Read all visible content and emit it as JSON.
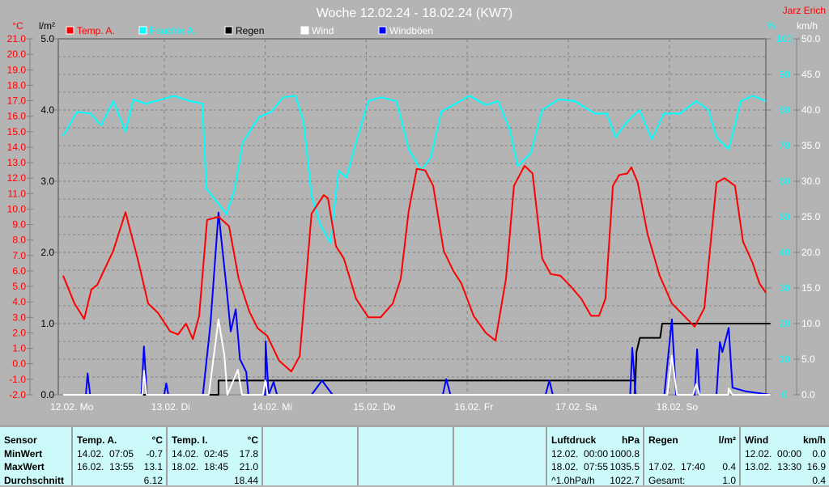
{
  "title": "Woche 12.02.24 - 18.02.24 (KW7)",
  "author": "Jarz Erich",
  "colors": {
    "temp": "#ff0000",
    "hum": "#00ffff",
    "rain": "#000000",
    "wind": "#ffffff",
    "gust": "#0000ff"
  },
  "chart_data": {
    "type": "line",
    "title": "Woche 12.02.24 - 18.02.24 (KW7)",
    "legend": [
      "Temp. A.",
      "Feuchte A.",
      "Regen",
      "Wind",
      "Windböen"
    ],
    "legend_position": "top",
    "axis_units": {
      "temp": "°C",
      "rain": "l/m²",
      "hum": "%",
      "wind": "km/h"
    },
    "xlim_hours": [
      0,
      168
    ],
    "x_tick_labels": [
      "12.02.  Mo",
      "13.02.  Di",
      "14.02.  Mi",
      "15.02.  Do",
      "16.02.  Fr",
      "17.02.  Sa",
      "18.02.  So"
    ],
    "ylim": {
      "temp": [
        -2,
        21
      ],
      "rain": [
        0,
        5
      ],
      "hum": [
        0,
        100
      ],
      "wind": [
        0,
        50
      ]
    },
    "temp_ticks": [
      "21.0",
      "20.0",
      "19.0",
      "18.0",
      "17.0",
      "16.0",
      "15.0",
      "14.0",
      "13.0",
      "12.0",
      "11.0",
      "10.0",
      "9.0",
      "8.0",
      "7.0",
      "6.0",
      "5.0",
      "4.0",
      "3.0",
      "2.0",
      "1.0",
      "0.0",
      "-1.0",
      "-2.0"
    ],
    "rain_ticks": [
      "5.0",
      "4.0",
      "3.0",
      "2.0",
      "1.0",
      "0.0"
    ],
    "hum_ticks": [
      "100",
      "90",
      "80",
      "70",
      "60",
      "50",
      "40",
      "30",
      "20",
      "10",
      "0"
    ],
    "wind_ticks": [
      "50.0",
      "45.0",
      "40.0",
      "35.0",
      "30.0",
      "25.0",
      "20.0",
      "15.0",
      "10.0",
      "5.0",
      "0.0"
    ],
    "series": [
      {
        "name": "Temp. A.",
        "axis": "temp",
        "points": [
          [
            0,
            5.7
          ],
          [
            2.7,
            3.9
          ],
          [
            5,
            2.9
          ],
          [
            6.7,
            4.8
          ],
          [
            8.1,
            5.1
          ],
          [
            11.9,
            7.3
          ],
          [
            14.8,
            9.8
          ],
          [
            17.7,
            6.8
          ],
          [
            20.2,
            3.9
          ],
          [
            22.5,
            3.3
          ],
          [
            25.4,
            2.1
          ],
          [
            27.3,
            1.9
          ],
          [
            29.2,
            2.6
          ],
          [
            30.8,
            1.6
          ],
          [
            32.3,
            3.1
          ],
          [
            34.2,
            9.3
          ],
          [
            36.9,
            9.5
          ],
          [
            39.4,
            8.9
          ],
          [
            41.7,
            5.5
          ],
          [
            44.2,
            3.4
          ],
          [
            46.2,
            2.3
          ],
          [
            48.5,
            1.8
          ],
          [
            51.3,
            0.2
          ],
          [
            54.2,
            -0.5
          ],
          [
            56.2,
            0.5
          ],
          [
            59,
            9.7
          ],
          [
            61.9,
            10.9
          ],
          [
            62.9,
            10.7
          ],
          [
            64.8,
            7.6
          ],
          [
            66.7,
            6.8
          ],
          [
            69.6,
            4.2
          ],
          [
            72.5,
            3.0
          ],
          [
            75.4,
            3.0
          ],
          [
            78.3,
            3.9
          ],
          [
            80.2,
            5.5
          ],
          [
            82.1,
            9.9
          ],
          [
            84,
            12.6
          ],
          [
            86,
            12.5
          ],
          [
            87.9,
            11.5
          ],
          [
            90.4,
            7.3
          ],
          [
            92.7,
            6.0
          ],
          [
            94.6,
            5.2
          ],
          [
            97.5,
            3.1
          ],
          [
            100.4,
            2.0
          ],
          [
            102.7,
            1.5
          ],
          [
            105.2,
            5.5
          ],
          [
            107.1,
            11.5
          ],
          [
            109.6,
            12.8
          ],
          [
            111.5,
            12.3
          ],
          [
            113.8,
            6.8
          ],
          [
            115.8,
            5.8
          ],
          [
            118.1,
            5.7
          ],
          [
            120.6,
            5.0
          ],
          [
            123.1,
            4.2
          ],
          [
            125.4,
            3.1
          ],
          [
            127.3,
            3.1
          ],
          [
            128.8,
            4.2
          ],
          [
            130.6,
            11.5
          ],
          [
            132.1,
            12.2
          ],
          [
            134,
            12.3
          ],
          [
            135,
            12.7
          ],
          [
            136.5,
            11.7
          ],
          [
            138.8,
            8.4
          ],
          [
            141.7,
            5.7
          ],
          [
            144.6,
            3.9
          ],
          [
            147.5,
            3.1
          ],
          [
            150,
            2.4
          ],
          [
            152.3,
            3.6
          ],
          [
            155.2,
            11.7
          ],
          [
            157.1,
            12.0
          ],
          [
            159.6,
            11.5
          ],
          [
            161.5,
            7.9
          ],
          [
            163.8,
            6.5
          ],
          [
            165.4,
            5.2
          ],
          [
            166.9,
            4.6
          ]
        ]
      },
      {
        "name": "Feuchte A.",
        "axis": "hum",
        "points": [
          [
            0,
            72.7
          ],
          [
            3.3,
            79.5
          ],
          [
            6.5,
            79
          ],
          [
            9,
            75.7
          ],
          [
            11.9,
            82.5
          ],
          [
            14.8,
            74
          ],
          [
            16.7,
            83
          ],
          [
            19.6,
            81.8
          ],
          [
            23.5,
            83
          ],
          [
            26.3,
            84
          ],
          [
            30.2,
            82.5
          ],
          [
            33.1,
            81.8
          ],
          [
            34,
            58
          ],
          [
            36,
            55
          ],
          [
            38.8,
            50.7
          ],
          [
            40.8,
            58
          ],
          [
            42.7,
            71
          ],
          [
            44.6,
            74.5
          ],
          [
            46.5,
            78
          ],
          [
            49.4,
            79.5
          ],
          [
            52.3,
            83.6
          ],
          [
            55.2,
            84
          ],
          [
            57.1,
            76.8
          ],
          [
            59,
            56
          ],
          [
            61,
            48
          ],
          [
            63.5,
            42.7
          ],
          [
            65.4,
            63
          ],
          [
            67.3,
            61
          ],
          [
            69.6,
            71
          ],
          [
            72.5,
            82.5
          ],
          [
            75.4,
            83.6
          ],
          [
            79.2,
            82.5
          ],
          [
            82.1,
            69
          ],
          [
            85,
            63
          ],
          [
            87.3,
            66.6
          ],
          [
            89.8,
            79.5
          ],
          [
            92.7,
            81.4
          ],
          [
            96.5,
            84
          ],
          [
            100.4,
            81.4
          ],
          [
            103.3,
            82.5
          ],
          [
            106.1,
            74.5
          ],
          [
            108,
            64.3
          ],
          [
            111,
            67.7
          ],
          [
            113.8,
            80
          ],
          [
            117.7,
            83
          ],
          [
            121.5,
            82.5
          ],
          [
            126.3,
            79
          ],
          [
            129.2,
            79
          ],
          [
            131.2,
            72.3
          ],
          [
            134,
            76.8
          ],
          [
            136.9,
            80
          ],
          [
            139.8,
            71.8
          ],
          [
            142.7,
            79
          ],
          [
            146.5,
            79
          ],
          [
            150.4,
            82.5
          ],
          [
            153.3,
            80
          ],
          [
            155.2,
            72.3
          ],
          [
            158.1,
            69
          ],
          [
            161,
            82.5
          ],
          [
            163.8,
            84
          ],
          [
            166.9,
            82.5
          ]
        ]
      },
      {
        "name": "Regen",
        "axis": "rain",
        "points": [
          [
            0,
            0
          ],
          [
            36.9,
            0
          ],
          [
            36.9,
            0.2
          ],
          [
            135.8,
            0.2
          ],
          [
            135.8,
            0
          ],
          [
            136.2,
            0.6
          ],
          [
            137,
            0.8
          ],
          [
            141.8,
            0.8
          ],
          [
            142.3,
            1.0
          ],
          [
            168,
            1.0
          ]
        ]
      },
      {
        "name": "Wind",
        "axis": "wind",
        "points": [
          [
            0,
            0
          ],
          [
            18.8,
            0
          ],
          [
            19.2,
            3.4
          ],
          [
            19.8,
            0
          ],
          [
            34.6,
            0
          ],
          [
            36.9,
            10.6
          ],
          [
            38.3,
            5.5
          ],
          [
            39,
            0
          ],
          [
            41.5,
            3.5
          ],
          [
            42.5,
            0
          ],
          [
            47.5,
            0
          ],
          [
            48,
            2
          ],
          [
            48.6,
            0
          ],
          [
            143.5,
            0
          ],
          [
            144.6,
            5.5
          ],
          [
            145.8,
            0
          ],
          [
            149.6,
            0
          ],
          [
            150.4,
            1.5
          ],
          [
            151.2,
            0
          ],
          [
            158,
            0
          ],
          [
            158.1,
            0.9
          ],
          [
            159,
            0
          ],
          [
            168,
            0
          ]
        ]
      },
      {
        "name": "Windböen",
        "axis": "gust",
        "points": [
          [
            0,
            0
          ],
          [
            5.4,
            0
          ],
          [
            5.8,
            3
          ],
          [
            6.4,
            0
          ],
          [
            18.6,
            0
          ],
          [
            19.2,
            6.8
          ],
          [
            19.9,
            0
          ],
          [
            24,
            0
          ],
          [
            24.5,
            1.6
          ],
          [
            25,
            0
          ],
          [
            33.2,
            0
          ],
          [
            35,
            10
          ],
          [
            36.9,
            25.6
          ],
          [
            38.8,
            15
          ],
          [
            39.8,
            8.9
          ],
          [
            41,
            12
          ],
          [
            42,
            5
          ],
          [
            43.5,
            3.2
          ],
          [
            44,
            0
          ],
          [
            48,
            0
          ],
          [
            48.1,
            7.5
          ],
          [
            48.8,
            0
          ],
          [
            50,
            1.8
          ],
          [
            50.8,
            0
          ],
          [
            59,
            0
          ],
          [
            61.5,
            2
          ],
          [
            64,
            0
          ],
          [
            90.2,
            0
          ],
          [
            91,
            2.2
          ],
          [
            92,
            0
          ],
          [
            114.6,
            0
          ],
          [
            115.5,
            2
          ],
          [
            116.3,
            0
          ],
          [
            134.7,
            0
          ],
          [
            135.2,
            6.6
          ],
          [
            136,
            0
          ],
          [
            142.8,
            0
          ],
          [
            144.6,
            10.6
          ],
          [
            145.6,
            0
          ],
          [
            150,
            0
          ],
          [
            150.6,
            6.4
          ],
          [
            151.2,
            0
          ],
          [
            155.2,
            0
          ],
          [
            156,
            7.4
          ],
          [
            156.6,
            6
          ],
          [
            158.1,
            9.4
          ],
          [
            159,
            1
          ],
          [
            162,
            0.5
          ],
          [
            168,
            0
          ]
        ]
      }
    ]
  },
  "table": {
    "sensor_col": [
      "Sensor",
      "MinWert",
      "MaxWert",
      "Durchschnitt"
    ],
    "temp_a": {
      "header": "Temp. A.",
      "unit": "°C",
      "min_time": "14.02.  07:05",
      "min": "-0.7",
      "max_time": "16.02.  13:55",
      "max": "13.1",
      "avg": "6.12"
    },
    "temp_i": {
      "header": "Temp. I.",
      "unit": "°C",
      "min_time": "14.02.  02:45",
      "min": "17.8",
      "max_time": "18.02.  18:45",
      "max": "21.0",
      "avg": "18.44"
    },
    "pressure": {
      "header": "Luftdruck",
      "unit": "hPa",
      "min_time": "12.02.  00:00",
      "min": "1000.8",
      "max_time": "18.02.  07:55",
      "max": "1035.5",
      "trend": "^1.0hPa/h",
      "avg": "1022.7"
    },
    "rain": {
      "header": "Regen",
      "unit": "l/m²",
      "max_time": "17.02.  17:40",
      "max": "0.4",
      "total_label": "Gesamt:",
      "total": "1.0"
    },
    "wind": {
      "header": "Wind",
      "unit": "km/h",
      "min_time": "12.02.  00:00",
      "min": "0.0",
      "max_time": "13.02.  13:30",
      "max": "16.9",
      "avg": "0.4"
    }
  }
}
